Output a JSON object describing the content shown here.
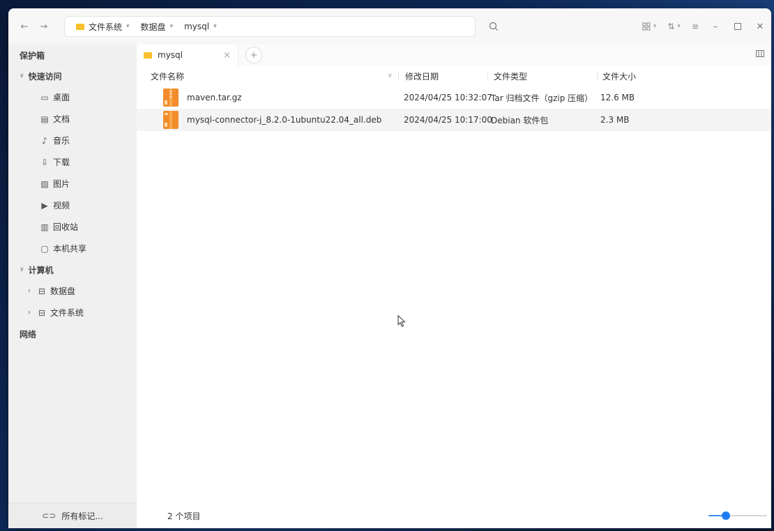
{
  "toolbar": {
    "crumbs": [
      {
        "label": "文件系统"
      },
      {
        "label": "数据盘"
      },
      {
        "label": "mysql"
      }
    ]
  },
  "sidebar": {
    "bookmarks_label": "保护箱",
    "quick_access_label": "快速访问",
    "quick_items": [
      {
        "label": "桌面",
        "icon": "desktop-icon"
      },
      {
        "label": "文档",
        "icon": "document-icon"
      },
      {
        "label": "音乐",
        "icon": "music-icon"
      },
      {
        "label": "下载",
        "icon": "download-icon"
      },
      {
        "label": "图片",
        "icon": "picture-icon"
      },
      {
        "label": "视频",
        "icon": "video-icon"
      },
      {
        "label": "回收站",
        "icon": "trash-icon"
      },
      {
        "label": "本机共享",
        "icon": "share-icon"
      }
    ],
    "computer_label": "计算机",
    "computer_items": [
      {
        "label": "数据盘",
        "icon": "drive-icon"
      },
      {
        "label": "文件系统",
        "icon": "drive-icon"
      }
    ],
    "network_label": "网络",
    "footer_label": "所有标记..."
  },
  "tabs": [
    {
      "label": "mysql"
    }
  ],
  "columns": {
    "name": "文件名称",
    "date": "修改日期",
    "type": "文件类型",
    "size": "文件大小"
  },
  "files": [
    {
      "name": "maven.tar.gz",
      "date": "2024/04/25 10:32:07",
      "type": "Tar 归档文件（gzip 压缩）",
      "size": "12.6 MB"
    },
    {
      "name": "mysql-connector-j_8.2.0-1ubuntu22.04_all.deb",
      "date": "2024/04/25 10:17:00",
      "type": "Debian 软件包",
      "size": "2.3 MB"
    }
  ],
  "status": {
    "count": "2 个项目",
    "zoom_fraction": 0.3
  },
  "colors": {
    "folder": "#f7c02c",
    "archive": "#f28c2a",
    "accent": "#1e7cf2"
  }
}
